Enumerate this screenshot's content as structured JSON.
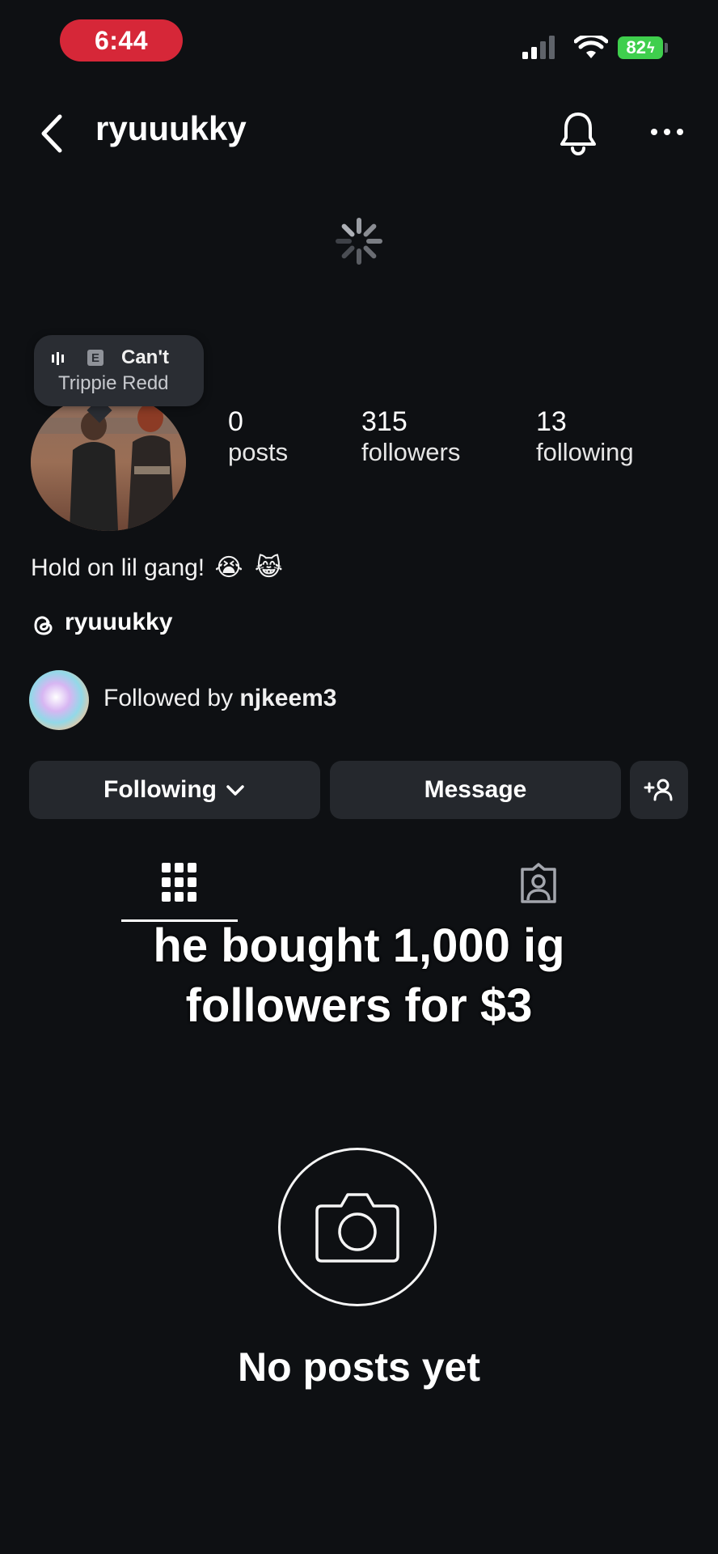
{
  "status_bar": {
    "time": "6:44",
    "battery": "82"
  },
  "header": {
    "username": "ryuuukky",
    "back_icon": "chevron-left-icon",
    "bell_icon": "bell-icon",
    "more_icon": "more-horizontal-icon"
  },
  "music_note": {
    "song": "Can't",
    "artist": "Trippie Redd",
    "badge": "E"
  },
  "stats": [
    {
      "value": "0",
      "label": "posts"
    },
    {
      "value": "315",
      "label": "followers"
    },
    {
      "value": "13",
      "label": "following"
    }
  ],
  "bio": "Hold on lil gang!",
  "bio_emoji": [
    "😭",
    "😹"
  ],
  "threads": {
    "handle": "ryuuukky",
    "icon": "threads-icon"
  },
  "followed_by": {
    "prefix": "Followed by",
    "user": "njkeem3"
  },
  "actions": {
    "following_label": "Following",
    "message_label": "Message",
    "add_user_icon": "add-user-icon"
  },
  "tabs": [
    {
      "name": "grid",
      "icon": "grid-icon",
      "active": true
    },
    {
      "name": "tagged",
      "icon": "tagged-person-icon",
      "active": false
    }
  ],
  "caption": {
    "line1": "he bought 1,000 ig",
    "line2": "followers for $3"
  },
  "empty_state": {
    "icon": "camera-icon",
    "title": "No posts yet"
  },
  "colors": {
    "background": "#0e1013",
    "time_pill": "#d62738",
    "battery": "#3fcf4d",
    "button": "#25282d"
  }
}
